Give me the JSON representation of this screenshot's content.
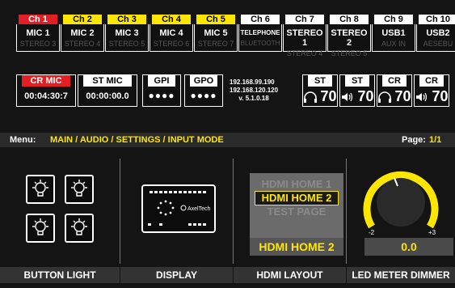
{
  "channels": [
    {
      "header": "Ch 1",
      "header_color": "red",
      "name": "MIC 1",
      "sub": "STEREO 3"
    },
    {
      "header": "Ch 2",
      "header_color": "yellow",
      "name": "MIC 2",
      "sub": "STEREO 4"
    },
    {
      "header": "Ch 3",
      "header_color": "yellow",
      "name": "MIC 3",
      "sub": "STEREO 5"
    },
    {
      "header": "Ch 4",
      "header_color": "yellow",
      "name": "MIC 4",
      "sub": "STEREO 6"
    },
    {
      "header": "Ch 5",
      "header_color": "yellow",
      "name": "MIC 5",
      "sub": "STEREO 7"
    },
    {
      "header": "Ch 6",
      "header_color": "white",
      "name": "TELEPHONE",
      "sub": "BLUETOOTH"
    },
    {
      "header": "Ch 7",
      "header_color": "white",
      "name": "STEREO 1",
      "sub": "STEREO 4"
    },
    {
      "header": "Ch 8",
      "header_color": "white",
      "name": "STEREO 2",
      "sub": "STEREO 5"
    },
    {
      "header": "Ch 9",
      "header_color": "white",
      "name": "USB1",
      "sub": "AUX IN"
    },
    {
      "header": "Ch 10",
      "header_color": "white",
      "name": "USB2",
      "sub": "AESEBU"
    }
  ],
  "status": {
    "cr_mic": {
      "label": "CR MIC",
      "value": "00:04:30:7"
    },
    "st_mic": {
      "label": "ST MIC",
      "value": "00:00:00.0"
    },
    "gpi": {
      "label": "GPI",
      "value": "●●●●"
    },
    "gpo": {
      "label": "GPO",
      "value": "●●●●"
    },
    "ip1": "192.168.99.190",
    "ip2": "192.168.120.120",
    "version": "v. 5.1.0.18",
    "meters": [
      {
        "label": "ST",
        "icon": "headphones-icon",
        "value": "70"
      },
      {
        "label": "ST",
        "icon": "speaker-icon",
        "value": "70"
      },
      {
        "label": "CR",
        "icon": "headphones-icon",
        "value": "70"
      },
      {
        "label": "CR",
        "icon": "speaker-icon",
        "value": "70"
      }
    ]
  },
  "menu": {
    "label": "Menu:",
    "path": "MAIN / AUDIO / SETTINGS / INPUT MODE",
    "page_label": "Page:",
    "page_value": "1/1"
  },
  "panels": {
    "button_light": {
      "title": "BUTTON LIGHT"
    },
    "display": {
      "title": "DISPLAY",
      "brand": "AxelTech"
    },
    "hdmi_layout": {
      "title": "HDMI LAYOUT",
      "options": [
        "HDMI HOME 1",
        "HDMI HOME 2",
        "TEST PAGE"
      ],
      "selected_index": 1,
      "value": "HDMI HOME 2"
    },
    "led_meter": {
      "title": "LED METER DIMMER",
      "min_label": "-2",
      "max_label": "+3",
      "value": "0.0"
    }
  },
  "colors": {
    "red": "#e31e24",
    "yellow": "#ffe600",
    "panel_bg": "#333333"
  }
}
